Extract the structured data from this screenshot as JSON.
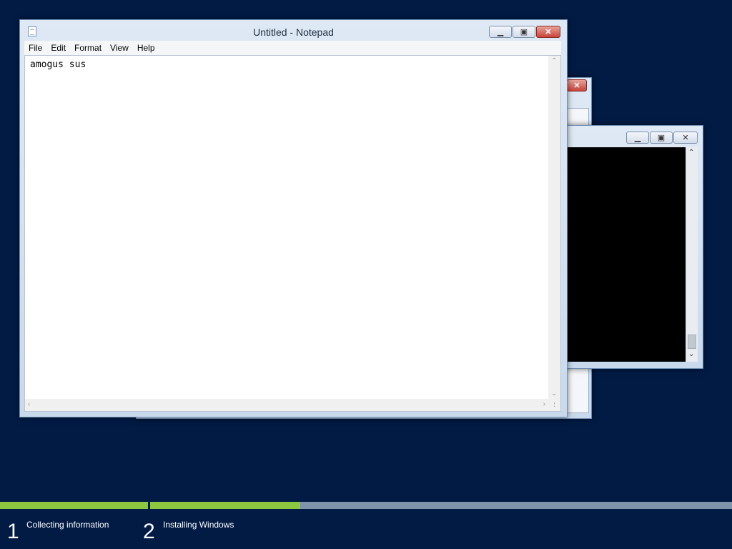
{
  "notepad": {
    "title": "Untitled - Notepad",
    "menu": [
      "File",
      "Edit",
      "Format",
      "View",
      "Help"
    ],
    "content": "amogus sus"
  },
  "setup": {
    "progress": [
      {
        "label": "Collecting information",
        "number": "1",
        "fraction": 1.0
      },
      {
        "label": "Installing Windows",
        "number": "2",
        "fraction": 0.258
      }
    ]
  },
  "colors": {
    "background": "#011b45",
    "progress_fill": "#8dc63f",
    "progress_track": "#7d94ab"
  }
}
